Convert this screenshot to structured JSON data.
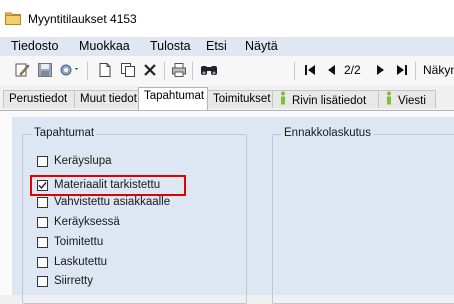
{
  "window": {
    "title": "Myyntitilaukset 4153",
    "app_icon": "folder-icon"
  },
  "menu": [
    "Tiedosto",
    "Muokkaa",
    "Tulosta",
    "Etsi",
    "Näytä"
  ],
  "toolbar": {
    "icons": [
      "edit-icon",
      "save-icon",
      "settings-icon",
      "new-document-icon",
      "copy-icon",
      "delete-icon",
      "print-icon",
      "binoculars-icon",
      "first-icon",
      "previous-icon",
      "next-icon",
      "last-icon"
    ],
    "page_counter": "2/2",
    "view_label": "Näkym"
  },
  "tabs": [
    {
      "label": "Perustiedot",
      "active": false
    },
    {
      "label": "Muut tiedot",
      "active": false
    },
    {
      "label": "Tapahtumat",
      "active": true
    },
    {
      "label": "Toimitukset",
      "active": false
    },
    {
      "label": "Rivin lisätiedot",
      "active": false,
      "icon": "info-icon"
    },
    {
      "label": "Viesti",
      "active": false,
      "icon": "info-icon"
    }
  ],
  "groups": {
    "events_title": "Tapahtumat",
    "prepayment_title": "Ennakkolaskutus"
  },
  "events": [
    {
      "label": "Keräyslupa",
      "checked": false
    },
    {
      "label": "Materiaalit tarkistettu",
      "checked": true
    },
    {
      "label": "Vahvistettu asiakkaalle",
      "checked": false
    },
    {
      "label": "Keräyksessä",
      "checked": false
    },
    {
      "label": "Toimitettu",
      "checked": false
    },
    {
      "label": "Laskutettu",
      "checked": false
    },
    {
      "label": "Siirretty",
      "checked": false
    }
  ],
  "colors": {
    "highlight": "#e00000",
    "panel_bg": "#dde6f3",
    "menu_bg": "#dfe7f2"
  }
}
